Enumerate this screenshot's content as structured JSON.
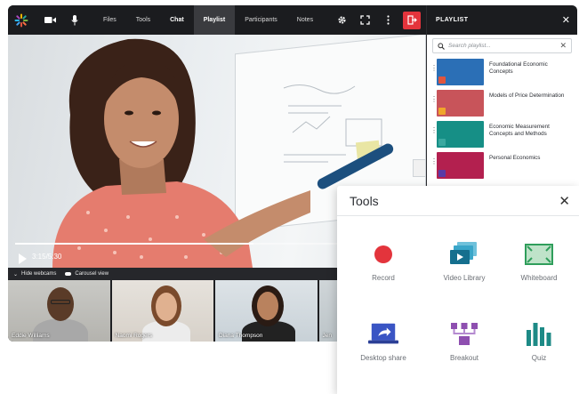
{
  "toolbar": {
    "tabs": [
      "Files",
      "Tools",
      "Chat",
      "Playlist",
      "Participants",
      "Notes"
    ],
    "active_tab": "Playlist",
    "icons": [
      "spark-logo-icon",
      "camera-icon",
      "microphone-icon",
      "gear-icon",
      "fullscreen-icon",
      "more-vertical-icon",
      "exit-icon"
    ]
  },
  "video": {
    "time": "3:15/5:30",
    "progress": 0.59
  },
  "webcam_bar": {
    "hide_label": "Hide webcams",
    "carousel_label": "Carousel view"
  },
  "webcams": [
    {
      "name": "Eddie Williams"
    },
    {
      "name": "Naomi Rogers"
    },
    {
      "name": "Diana Thompson"
    },
    {
      "name": "Jen"
    }
  ],
  "playlist": {
    "title": "PLAYLIST",
    "search_placeholder": "Search playlist...",
    "items": [
      {
        "label": "Foundational Economic Concepts",
        "thumb_color": "#2b6fb6",
        "badge_color": "#e0553e"
      },
      {
        "label": "Models of Price Determination",
        "thumb_color": "#c8545a",
        "badge_color": "#f0a52b"
      },
      {
        "label": "Economic Measurement Concepts and Methods",
        "thumb_color": "#168f86",
        "badge_color": "#3aa9a0"
      },
      {
        "label": "Personal Economics",
        "thumb_color": "#b3204f",
        "badge_color": "#5a3aa6"
      }
    ]
  },
  "tools_panel": {
    "title": "Tools",
    "tools": [
      {
        "label": "Record",
        "icon": "record-icon",
        "color": "#e3343c"
      },
      {
        "label": "Video Library",
        "icon": "video-library-icon",
        "color": "#1c8fb0"
      },
      {
        "label": "Whiteboard",
        "icon": "whiteboard-icon",
        "color": "#2f9e5b"
      },
      {
        "label": "Desktop share",
        "icon": "desktop-share-icon",
        "color": "#3a55c4"
      },
      {
        "label": "Breakout",
        "icon": "breakout-icon",
        "color": "#8e4fb0"
      },
      {
        "label": "Quiz",
        "icon": "quiz-icon",
        "color": "#1d8a86"
      }
    ]
  }
}
